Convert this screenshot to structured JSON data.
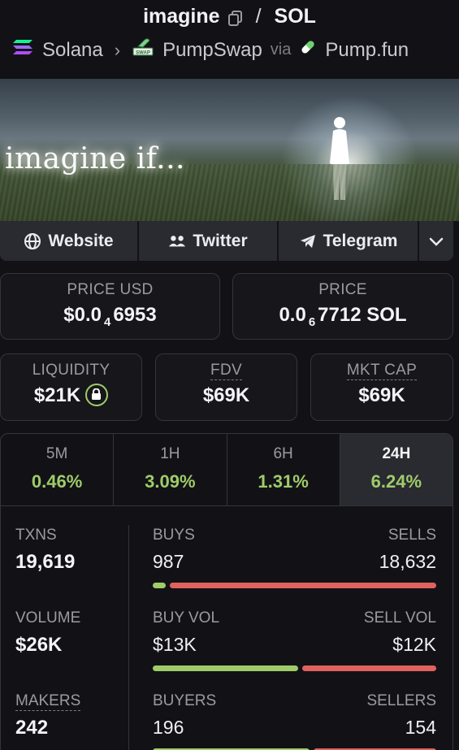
{
  "header": {
    "token": "imagine",
    "separator": "/",
    "quote": "SOL",
    "chain": "Solana",
    "dex": "PumpSwap",
    "via": "via",
    "launchpad": "Pump.fun"
  },
  "banner": {
    "tagline": "imagine if..."
  },
  "links": {
    "website": "Website",
    "twitter": "Twitter",
    "telegram": "Telegram"
  },
  "price": {
    "usd_label": "PRICE USD",
    "usd_prefix": "$0.0",
    "usd_zeros": "4",
    "usd_digits": "6953",
    "native_label": "PRICE",
    "native_prefix": "0.0",
    "native_zeros": "6",
    "native_digits": "7712 SOL"
  },
  "metrics": {
    "liquidity_label": "LIQUIDITY",
    "liquidity_value": "$21K",
    "fdv_label": "FDV",
    "fdv_value": "$69K",
    "mktcap_label": "MKT CAP",
    "mktcap_value": "$69K"
  },
  "tabs": [
    {
      "label": "5M",
      "change": "0.46%"
    },
    {
      "label": "1H",
      "change": "3.09%"
    },
    {
      "label": "6H",
      "change": "1.31%"
    },
    {
      "label": "24H",
      "change": "6.24%"
    }
  ],
  "stats": {
    "txns_label": "TXNS",
    "txns_value": "19,619",
    "buys_label": "BUYS",
    "buys_value": "987",
    "sells_label": "SELLS",
    "sells_value": "18,632",
    "buys_fraction": 0.05,
    "volume_label": "VOLUME",
    "volume_value": "$26K",
    "buyvol_label": "BUY VOL",
    "buyvol_value": "$13K",
    "sellvol_label": "SELL VOL",
    "sellvol_value": "$12K",
    "buyvol_fraction": 0.52,
    "makers_label": "MAKERS",
    "makers_value": "242",
    "buyers_label": "BUYERS",
    "buyers_value": "196",
    "sellers_label": "SELLERS",
    "sellers_value": "154",
    "buyers_fraction": 0.56
  },
  "colors": {
    "positive": "#9fcc69",
    "negative": "#e0625e",
    "panel": "#2a2a31"
  }
}
